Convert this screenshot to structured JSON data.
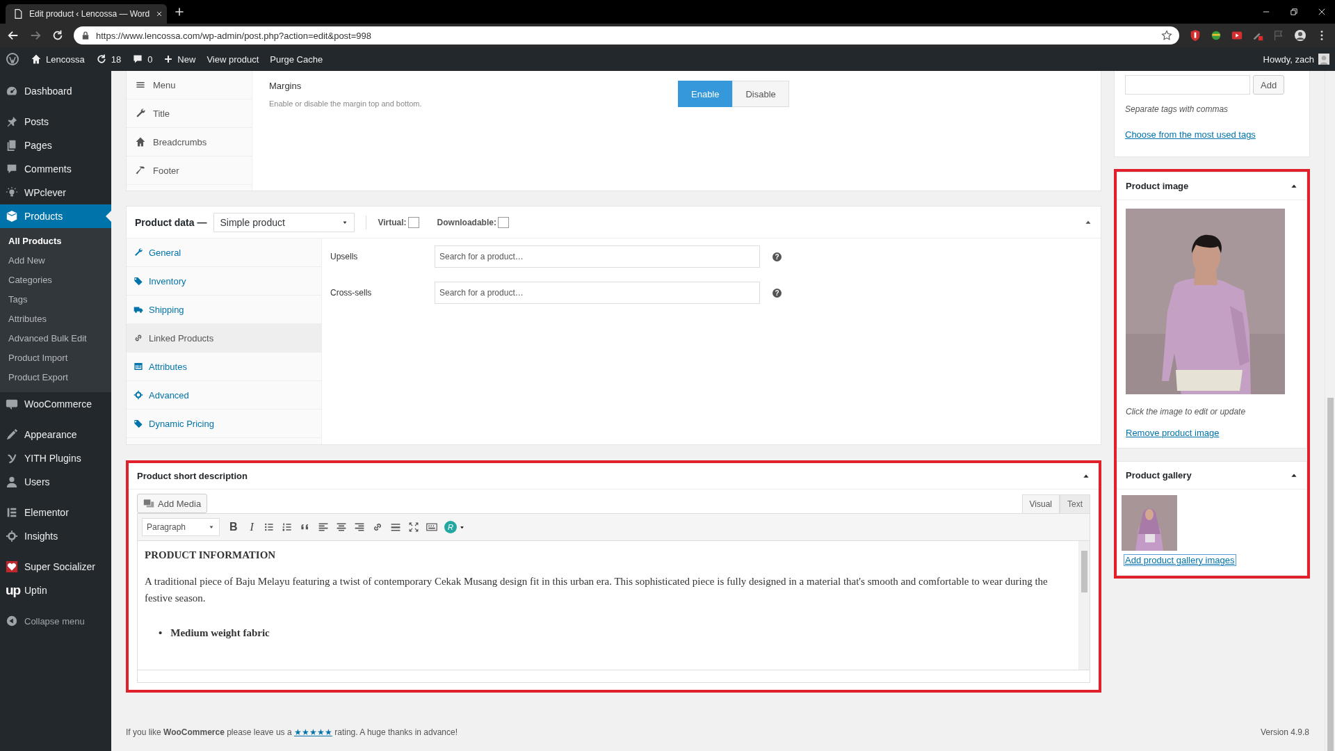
{
  "browser": {
    "tab_title": "Edit product ‹ Lencossa — Word",
    "url": "https://www.lencossa.com/wp-admin/post.php?action=edit&post=998"
  },
  "admin_bar": {
    "site": "Lencossa",
    "updates": "18",
    "comments": "0",
    "new": "New",
    "links": [
      "View product",
      "Purge Cache"
    ],
    "greeting": "Howdy, zach"
  },
  "sidebar": {
    "groups": [
      [
        {
          "label": "Dashboard",
          "selected": false
        }
      ],
      [
        {
          "label": "Posts",
          "selected": false
        },
        {
          "label": "Pages",
          "selected": false
        },
        {
          "label": "Comments",
          "selected": false
        },
        {
          "label": "WPclever",
          "selected": false
        },
        {
          "label": "Products",
          "selected": true,
          "children": [
            {
              "label": "All Products",
              "selected": true
            },
            {
              "label": "Add New",
              "selected": false
            },
            {
              "label": "Categories",
              "selected": false
            },
            {
              "label": "Tags",
              "selected": false
            },
            {
              "label": "Attributes",
              "selected": false
            },
            {
              "label": "Advanced Bulk Edit",
              "selected": false
            },
            {
              "label": "Product Import",
              "selected": false
            },
            {
              "label": "Product Export",
              "selected": false
            }
          ]
        },
        {
          "label": "WooCommerce",
          "selected": false
        }
      ],
      [
        {
          "label": "Appearance",
          "selected": false
        },
        {
          "label": "YITH Plugins",
          "selected": false
        },
        {
          "label": "Users",
          "selected": false
        }
      ],
      [
        {
          "label": "Elementor",
          "selected": false
        },
        {
          "label": "Insights",
          "selected": false
        }
      ],
      [
        {
          "label": "Super Socializer",
          "selected": false
        },
        {
          "label": "Uptin",
          "selected": false,
          "logo": "up"
        }
      ]
    ],
    "collapse": "Collapse menu"
  },
  "theme_options": {
    "tabs": [
      {
        "label": "Menu",
        "selected": false
      },
      {
        "label": "Title",
        "selected": false
      },
      {
        "label": "Breadcrumbs",
        "selected": false
      },
      {
        "label": "Footer",
        "selected": false
      }
    ],
    "setting": {
      "label": "Margins",
      "description": "Enable or disable the margin top and bottom.",
      "options": [
        {
          "label": "Enable",
          "selected": true
        },
        {
          "label": "Disable",
          "selected": false
        }
      ]
    }
  },
  "product_data": {
    "title": "Product data —",
    "product_type": "Simple product",
    "checkboxes": [
      {
        "label": "Virtual:",
        "checked": false
      },
      {
        "label": "Downloadable:",
        "checked": false
      }
    ],
    "tabs": [
      {
        "label": "General",
        "selected": false
      },
      {
        "label": "Inventory",
        "selected": false
      },
      {
        "label": "Shipping",
        "selected": false
      },
      {
        "label": "Linked Products",
        "selected": true
      },
      {
        "label": "Attributes",
        "selected": false
      },
      {
        "label": "Advanced",
        "selected": false
      },
      {
        "label": "Dynamic Pricing",
        "selected": false
      }
    ],
    "fields": [
      {
        "label": "Upsells",
        "placeholder": "Search for a product…",
        "help": "?"
      },
      {
        "label": "Cross-sells",
        "placeholder": "Search for a product…",
        "help": "?"
      }
    ]
  },
  "editor": {
    "title": "Product short description",
    "highlighted": true,
    "add_media": "Add Media",
    "modes": [
      {
        "label": "Visual",
        "selected": true
      },
      {
        "label": "Text",
        "selected": false
      }
    ],
    "format": "Paragraph",
    "bold": "B",
    "italic": "I",
    "plugin": "R",
    "heading": "PRODUCT INFORMATION",
    "paragraph": "A traditional piece of Baju Melayu featuring a twist of contemporary Cekak Musang design fit in this urban era. This sophisticated piece is fully designed in a material that's smooth and comfortable to wear during the festive season.",
    "bullets": [
      {
        "marker": "•",
        "text": "Medium weight fabric"
      }
    ]
  },
  "tags": {
    "add": "Add",
    "hint": "Separate tags with commas",
    "link": "Choose from the most used tags"
  },
  "media": {
    "highlighted": true,
    "image": {
      "title": "Product image",
      "hint": "Click the image to edit or update",
      "link": "Remove product image"
    },
    "gallery": {
      "title": "Product gallery",
      "link": "Add product gallery images"
    }
  },
  "footer": {
    "before": "If you like **WooCommerce** please leave us a",
    "link": "★★★★★",
    "after": "rating. A huge thanks in advance!",
    "version": "Version 4.9.8"
  }
}
